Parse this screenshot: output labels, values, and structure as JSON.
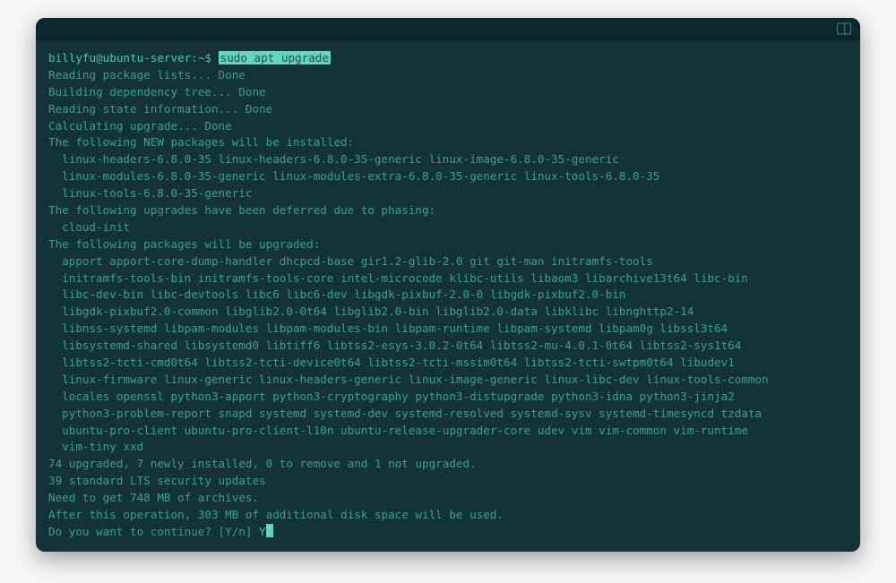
{
  "prompt": {
    "user": "billyfu",
    "host": "ubuntu-server",
    "path": "~",
    "symbol": "$",
    "command": "sudo apt upgrade"
  },
  "lines": {
    "reading_pkg": "Reading package lists... Done",
    "building_dep": "Building dependency tree... Done",
    "reading_state": "Reading state information... Done",
    "calc_upgrade": "Calculating upgrade... Done",
    "new_pkg_header": "The following NEW packages will be installed:",
    "new_pkg_1": "linux-headers-6.8.0-35 linux-headers-6.8.0-35-generic linux-image-6.8.0-35-generic",
    "new_pkg_2": "linux-modules-6.8.0-35-generic linux-modules-extra-6.8.0-35-generic linux-tools-6.8.0-35",
    "new_pkg_3": "linux-tools-6.8.0-35-generic",
    "deferred_header": "The following upgrades have been deferred due to phasing:",
    "deferred_1": "cloud-init",
    "upgraded_header": "The following packages will be upgraded:",
    "upg_1": "apport apport-core-dump-handler dhcpcd-base gir1.2-glib-2.0 git git-man initramfs-tools",
    "upg_2": "initramfs-tools-bin initramfs-tools-core intel-microcode klibc-utils libaom3 libarchive13t64 libc-bin",
    "upg_3": "libc-dev-bin libc-devtools libc6 libc6-dev libgdk-pixbuf-2.0-0 libgdk-pixbuf2.0-bin",
    "upg_4": "libgdk-pixbuf2.0-common libglib2.0-0t64 libglib2.0-bin libglib2.0-data libklibc libnghttp2-14",
    "upg_5": "libnss-systemd libpam-modules libpam-modules-bin libpam-runtime libpam-systemd libpam0g libssl3t64",
    "upg_6": "libsystemd-shared libsystemd0 libtiff6 libtss2-esys-3.0.2-0t64 libtss2-mu-4.0.1-0t64 libtss2-sys1t64",
    "upg_7": "libtss2-tcti-cmd0t64 libtss2-tcti-device0t64 libtss2-tcti-mssim0t64 libtss2-tcti-swtpm0t64 libudev1",
    "upg_8": "linux-firmware linux-generic linux-headers-generic linux-image-generic linux-libc-dev linux-tools-common",
    "upg_9": "locales openssl python3-apport python3-cryptography python3-distupgrade python3-idna python3-jinja2",
    "upg_10": "python3-problem-report snapd systemd systemd-dev systemd-resolved systemd-sysv systemd-timesyncd tzdata",
    "upg_11": "ubuntu-pro-client ubuntu-pro-client-l10n ubuntu-release-upgrader-core udev vim vim-common vim-runtime",
    "upg_12": "vim-tiny xxd",
    "summary": "74 upgraded, 7 newly installed, 0 to remove and 1 not upgraded.",
    "security": "39 standard LTS security updates",
    "need_get": "Need to get 748 MB of archives.",
    "after_op": "After this operation, 303 MB of additional disk space will be used.",
    "continue_q": "Do you want to continue? [Y/n] ",
    "input": "Y"
  }
}
